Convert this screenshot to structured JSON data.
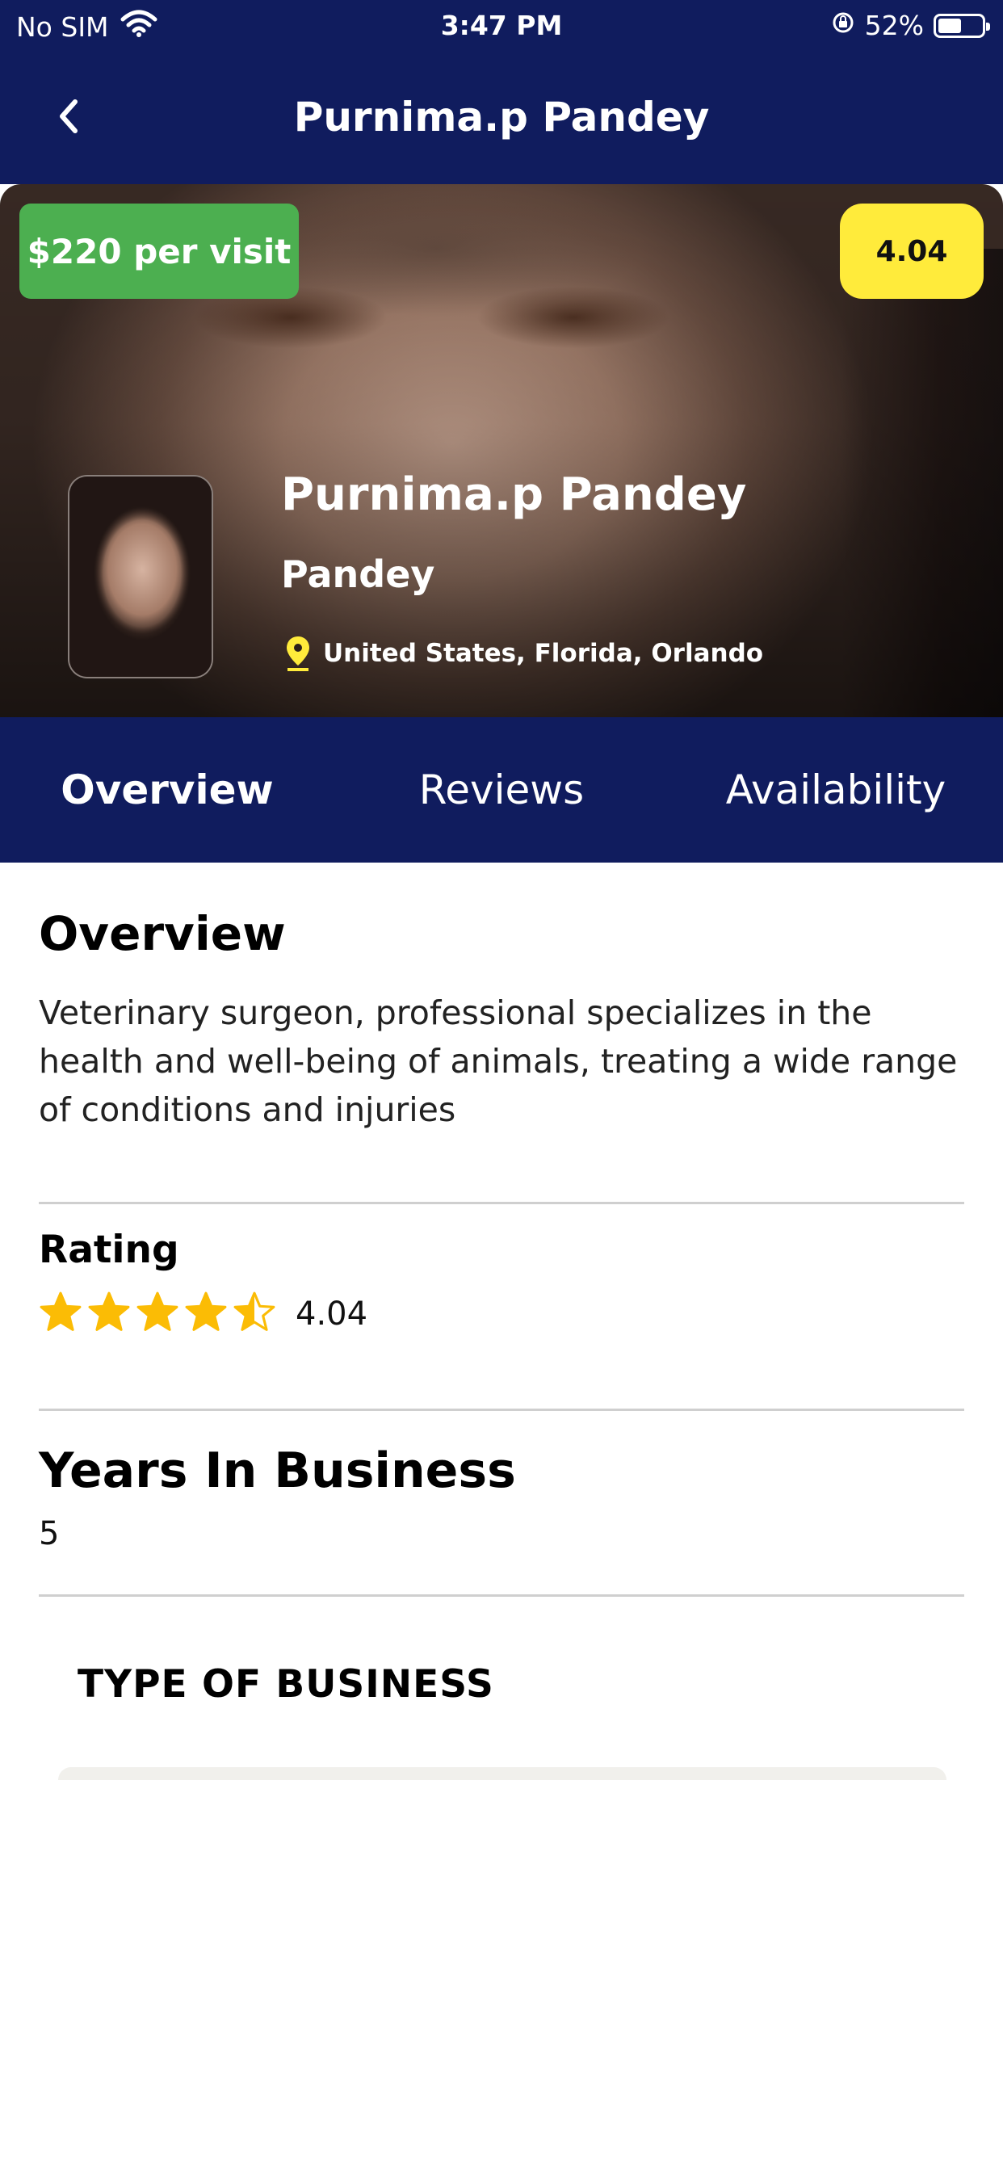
{
  "status_bar": {
    "carrier": "No SIM",
    "time": "3:47 PM",
    "battery_percent": "52%",
    "battery_level": 0.52
  },
  "nav": {
    "title": "Purnima.p Pandey",
    "back_icon": "chevron-left-icon"
  },
  "hero": {
    "price_badge": "$220 per visit",
    "rating_badge": "4.04",
    "name": "Purnima.p Pandey",
    "subtitle": "Pandey",
    "location": "United States, Florida, Orlando",
    "location_icon": "map-pin-icon"
  },
  "tabs": [
    {
      "label": "Overview",
      "active": true
    },
    {
      "label": "Reviews",
      "active": false
    },
    {
      "label": "Availability",
      "active": false
    }
  ],
  "overview": {
    "heading": "Overview",
    "description": "Veterinary surgeon, professional specializes in the health and well-being of animals, treating a wide range of conditions and injuries"
  },
  "rating": {
    "heading": "Rating",
    "value": "4.04",
    "stars_filled": 4.04,
    "stars_max": 5
  },
  "years": {
    "heading": "Years In Business",
    "value": "5"
  },
  "type_of_business": {
    "heading": "TYPE OF BUSINESS"
  },
  "colors": {
    "header_bg": "#101c5e",
    "price_badge": "#4caf50",
    "rating_badge": "#ffeb3b",
    "star": "#fbbc05"
  }
}
